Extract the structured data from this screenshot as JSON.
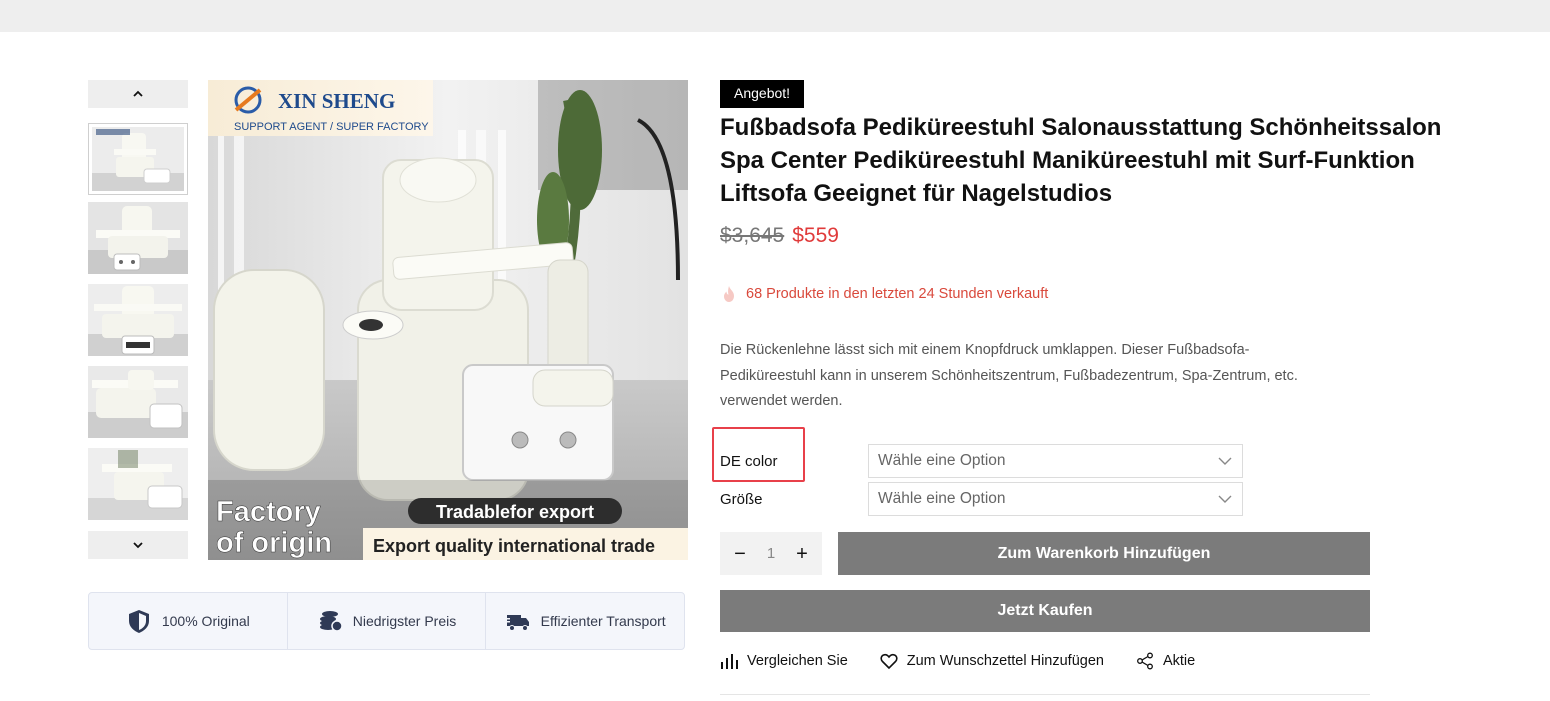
{
  "gallery": {
    "prev_icon": "chevron-up-icon",
    "next_icon": "chevron-down-icon",
    "thumbnails": [
      "thumb-1",
      "thumb-2",
      "thumb-3",
      "thumb-4",
      "thumb-5"
    ],
    "main_image": {
      "brand": "XIN SHENG",
      "tagline": "SUPPORT AGENT / SUPER FACTORY",
      "factory_line1": "Factory",
      "factory_line2": "of origin",
      "export_pill": "Tradablefor export",
      "export_text": "Export quality international trade"
    }
  },
  "features": [
    {
      "label": "100% Original",
      "icon": "shield-icon"
    },
    {
      "label": "Niedrigster Preis",
      "icon": "coins-icon"
    },
    {
      "label": "Effizienter Transport",
      "icon": "truck-icon"
    }
  ],
  "product": {
    "badge": "Angebot!",
    "title": "Fußbadsofa Pediküreestuhl Salonausstattung Schönheitssalon Spa Center Pediküreestuhl Maniküreestuhl mit Surf-Funktion Liftsofa Geeignet für Nagelstudios",
    "old_price": "$3,645",
    "new_price": "$559",
    "sold_text": "68 Produkte in den letzten 24 Stunden verkauft",
    "description": "Die Rückenlehne lässt sich mit einem Knopfdruck umklappen. Dieser Fußbadsofa-Pediküreestuhl kann in unserem Schönheitszentrum, Fußbadezentrum, Spa-Zentrum, etc. verwendet werden."
  },
  "variations": [
    {
      "label": "DE color",
      "selected": "Wähle eine Option"
    },
    {
      "label": "Größe",
      "selected": "Wähle eine Option"
    }
  ],
  "quantity": {
    "value": "1",
    "minus": "−",
    "plus": "+"
  },
  "buttons": {
    "add_to_cart": "Zum Warenkorb Hinzufügen",
    "buy_now": "Jetzt Kaufen"
  },
  "actions": [
    {
      "label": "Vergleichen Sie",
      "icon": "compare-icon"
    },
    {
      "label": "Zum Wunschzettel Hinzufügen",
      "icon": "heart-icon"
    },
    {
      "label": "Aktie",
      "icon": "share-icon"
    }
  ],
  "colors": {
    "sale_price": "#e03a3a",
    "button_bg": "#7b7b7b",
    "highlight": "#e8404a",
    "badge_bg": "#000000"
  }
}
